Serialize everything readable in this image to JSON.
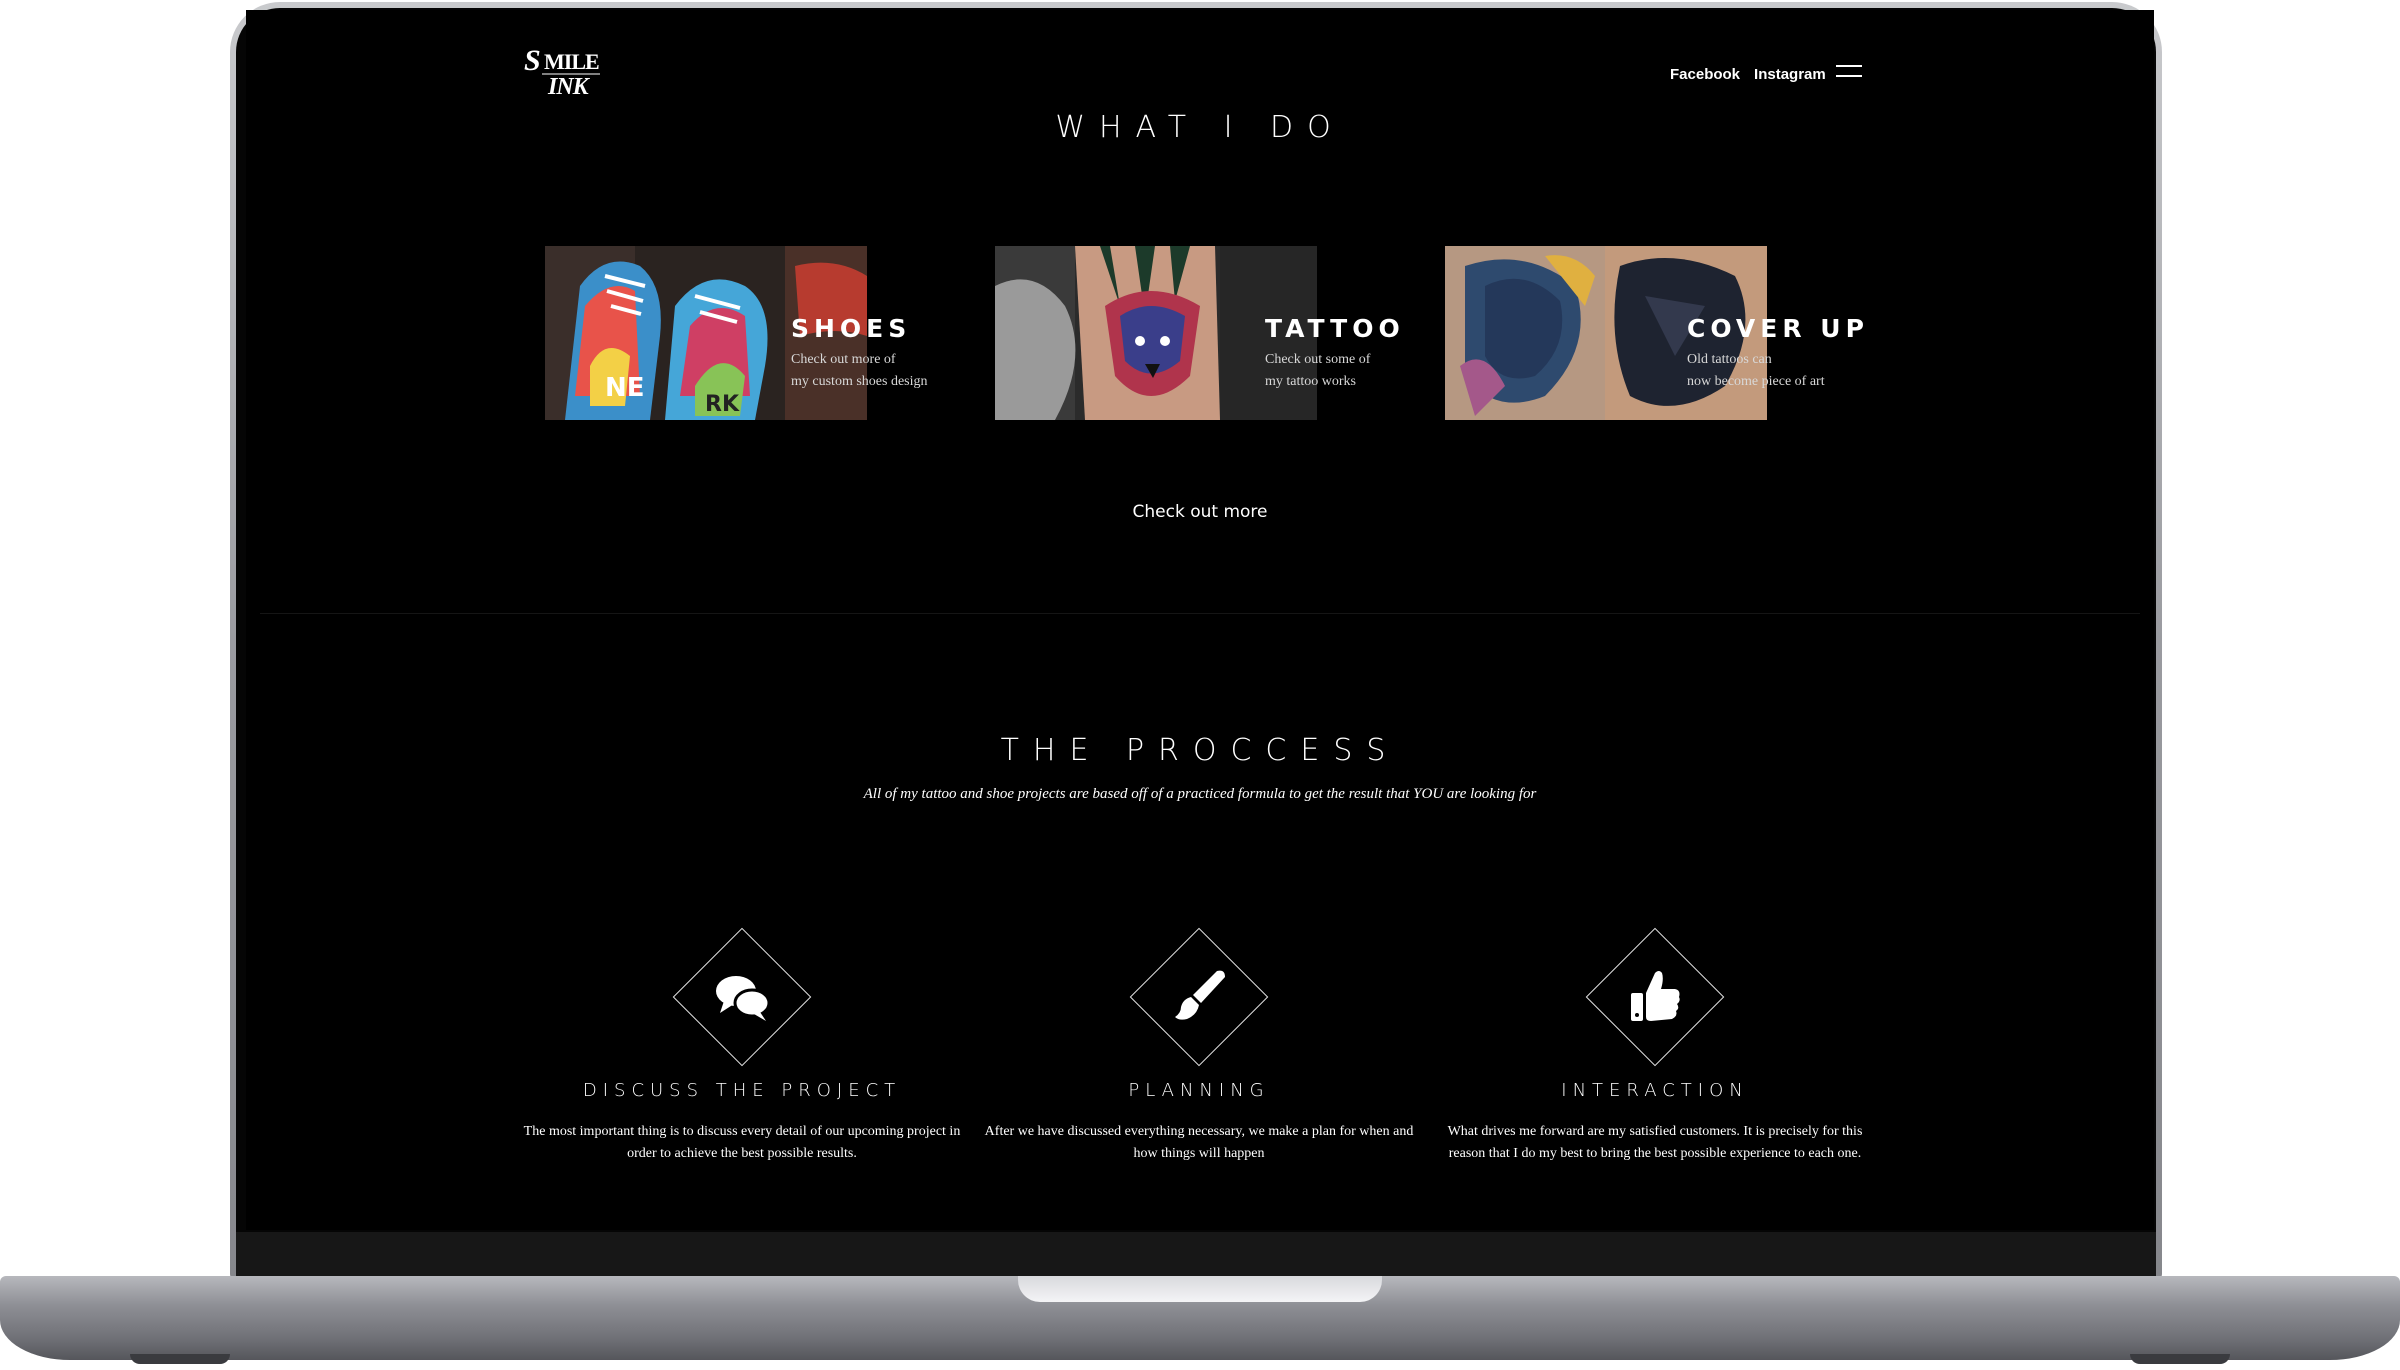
{
  "brand": {
    "logo_text": "SMILE INK"
  },
  "nav": {
    "links": [
      "Facebook",
      "Instagram"
    ],
    "menu_icon": "hamburger-menu-icon"
  },
  "what_i_do": {
    "title": "WHAT I DO",
    "services": [
      {
        "title": "SHOES",
        "desc_line1": "Check out more of",
        "desc_line2": "my custom shoes design"
      },
      {
        "title": "TATTOO",
        "desc_line1": "Check out some of",
        "desc_line2": "my tattoo works"
      },
      {
        "title": "COVER UP",
        "desc_line1": "Old tattoos can",
        "desc_line2": "now become piece of art"
      }
    ],
    "cta": "Check out more"
  },
  "process": {
    "title": "THE PROCCESS",
    "subtitle": "All of my tattoo and shoe projects are based off of a practiced formula to get the result that YOU are looking for",
    "steps": [
      {
        "icon": "speech-bubbles-icon",
        "title": "DISCUSS THE PROJECT",
        "desc": "The most important thing is to discuss every detail of our upcoming project in order to achieve the best possible results."
      },
      {
        "icon": "paintbrush-icon",
        "title": "PLANNING",
        "desc": "After we have discussed everything necessary, we make a plan for when and how things will happen"
      },
      {
        "icon": "thumbs-up-icon",
        "title": "INTERACTION",
        "desc": "What drives me forward are my satisfied customers. It is precisely for this reason that I do my best to bring the best possible experience to each one."
      }
    ]
  },
  "colors": {
    "background": "#000000",
    "text": "#ffffff",
    "device_frame": "#8e8f95"
  }
}
